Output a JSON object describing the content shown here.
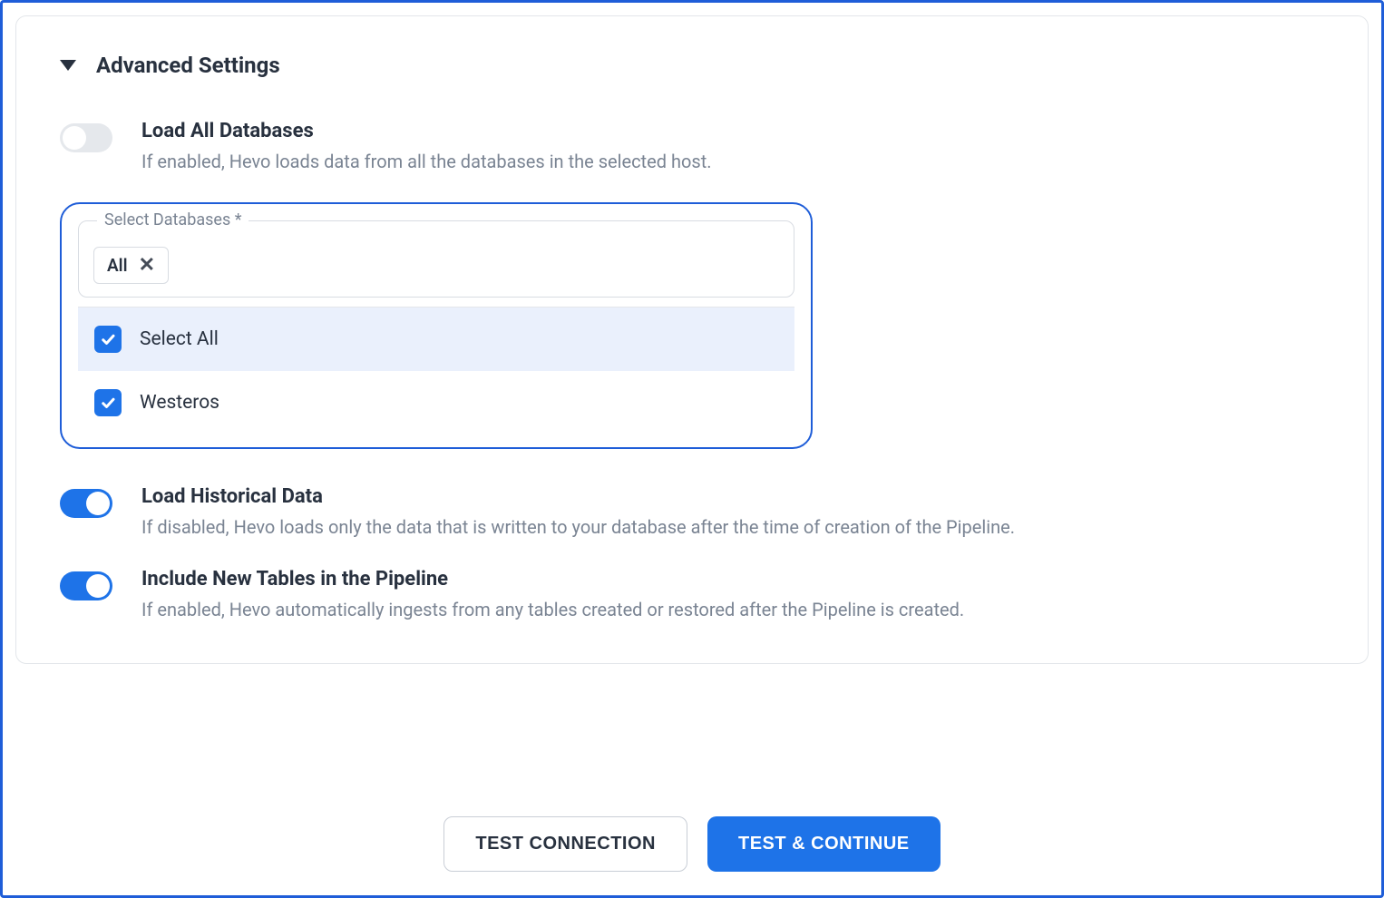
{
  "section": {
    "title": "Advanced Settings"
  },
  "settings": {
    "loadAllDatabases": {
      "label": "Load All Databases",
      "desc": "If enabled, Hevo loads data from all the databases in the selected host.",
      "enabled": false
    },
    "loadHistoricalData": {
      "label": "Load Historical Data",
      "desc": "If disabled, Hevo loads only the data that is written to your database after the time of creation of the Pipeline.",
      "enabled": true
    },
    "includeNewTables": {
      "label": "Include New Tables in the Pipeline",
      "desc": "If enabled, Hevo automatically ingests from any tables created or restored after the Pipeline is created.",
      "enabled": true
    }
  },
  "selectDatabases": {
    "legend": "Select Databases *",
    "chip": "All",
    "options": {
      "selectAll": {
        "label": "Select All",
        "checked": true
      },
      "westeros": {
        "label": "Westeros",
        "checked": true
      }
    }
  },
  "footer": {
    "testConnection": "TEST CONNECTION",
    "testContinue": "TEST & CONTINUE"
  }
}
